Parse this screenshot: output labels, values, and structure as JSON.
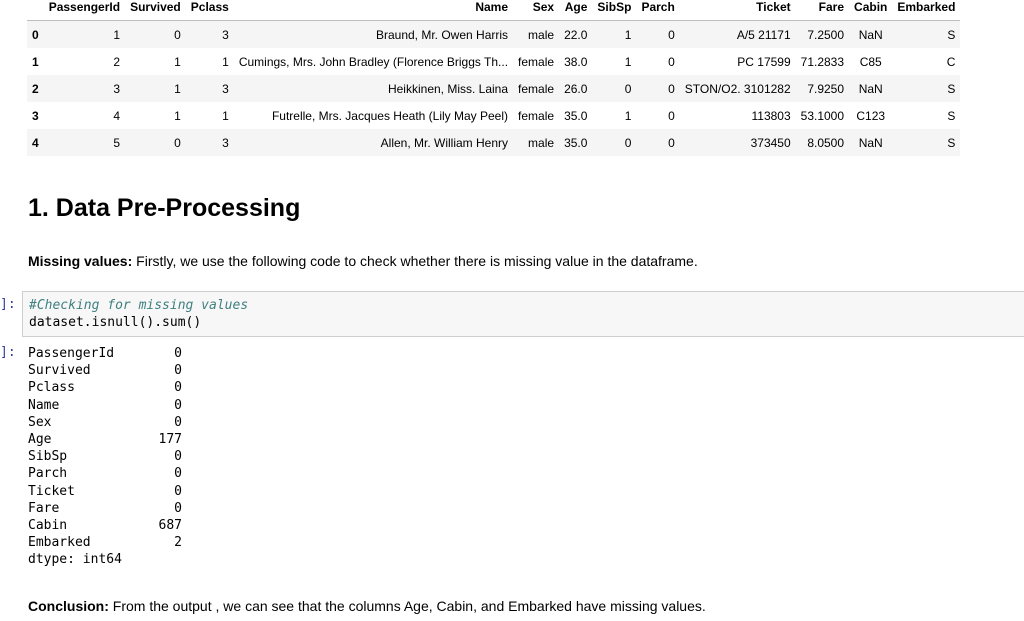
{
  "dataframe": {
    "columns": [
      "PassengerId",
      "Survived",
      "Pclass",
      "Name",
      "Sex",
      "Age",
      "SibSp",
      "Parch",
      "Ticket",
      "Fare",
      "Cabin",
      "Embarked"
    ],
    "rows": [
      {
        "index": "0",
        "cells": [
          "1",
          "0",
          "3",
          "Braund, Mr. Owen Harris",
          "male",
          "22.0",
          "1",
          "0",
          "A/5 21171",
          "7.2500",
          "NaN",
          "S"
        ]
      },
      {
        "index": "1",
        "cells": [
          "2",
          "1",
          "1",
          "Cumings, Mrs. John Bradley (Florence Briggs Th...",
          "female",
          "38.0",
          "1",
          "0",
          "PC 17599",
          "71.2833",
          "C85",
          "C"
        ]
      },
      {
        "index": "2",
        "cells": [
          "3",
          "1",
          "3",
          "Heikkinen, Miss. Laina",
          "female",
          "26.0",
          "0",
          "0",
          "STON/O2. 3101282",
          "7.9250",
          "NaN",
          "S"
        ]
      },
      {
        "index": "3",
        "cells": [
          "4",
          "1",
          "1",
          "Futrelle, Mrs. Jacques Heath (Lily May Peel)",
          "female",
          "35.0",
          "1",
          "0",
          "113803",
          "53.1000",
          "C123",
          "S"
        ]
      },
      {
        "index": "4",
        "cells": [
          "5",
          "0",
          "3",
          "Allen, Mr. William Henry",
          "male",
          "35.0",
          "0",
          "0",
          "373450",
          "8.0500",
          "NaN",
          "S"
        ]
      }
    ]
  },
  "section": {
    "heading": "1. Data Pre-Processing",
    "missing_label": "Missing values:",
    "missing_text": " Firstly, we use the following code to check whether there is missing value in the dataframe."
  },
  "code_cell": {
    "in_prompt": "]:",
    "comment": "#Checking for missing values",
    "code": "dataset.isnull().sum()"
  },
  "output_cell": {
    "out_prompt": "]:",
    "rows": [
      {
        "name": "PassengerId",
        "value": "0"
      },
      {
        "name": "Survived",
        "value": "0"
      },
      {
        "name": "Pclass",
        "value": "0"
      },
      {
        "name": "Name",
        "value": "0"
      },
      {
        "name": "Sex",
        "value": "0"
      },
      {
        "name": "Age",
        "value": "177"
      },
      {
        "name": "SibSp",
        "value": "0"
      },
      {
        "name": "Parch",
        "value": "0"
      },
      {
        "name": "Ticket",
        "value": "0"
      },
      {
        "name": "Fare",
        "value": "0"
      },
      {
        "name": "Cabin",
        "value": "687"
      },
      {
        "name": "Embarked",
        "value": "2"
      }
    ],
    "dtype": "dtype: int64"
  },
  "conclusion": {
    "label": "Conclusion:",
    "text": " From the output , we can see that the columns Age, Cabin, and Embarked have missing values."
  },
  "colors": {
    "prompt": "#303f9f",
    "comment": "#408080",
    "code_bg": "#f7f7f7",
    "row_stripe": "#f5f5f5"
  }
}
